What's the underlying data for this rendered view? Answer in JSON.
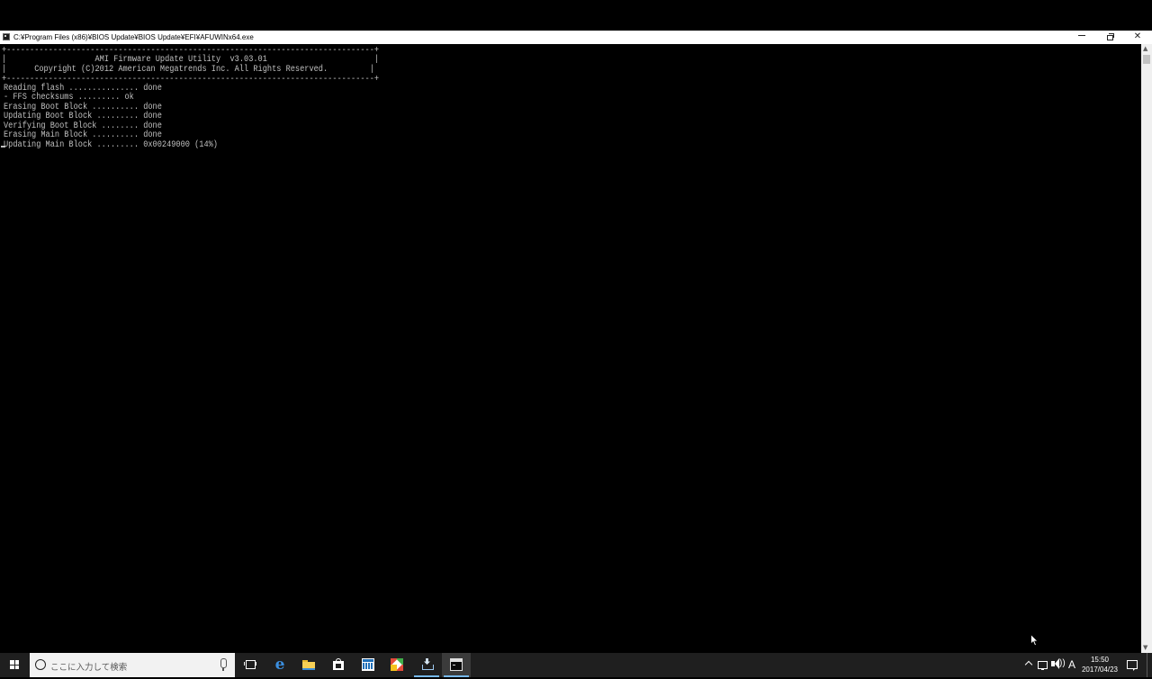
{
  "window": {
    "title": "C:¥Program Files (x86)¥BIOS Update¥BIOS Update¥EFI¥AFUWINx64.exe",
    "controls": {
      "minimize": "minimize",
      "maximize": "restore",
      "close": "✕"
    }
  },
  "console": {
    "lines": [
      "+-------------------------------------------------------------------------------+",
      "|                   AMI Firmware Update Utility  v3.03.01                       |",
      "|      Copyright (C)2012 American Megatrends Inc. All Rights Reserved.         |",
      "+-------------------------------------------------------------------------------+",
      "Reading flash ............... done",
      "- FFS checksums ......... ok",
      "Erasing Boot Block .......... done",
      "Updating Boot Block ......... done",
      "Verifying Boot Block ........ done",
      "Erasing Main Block .......... done",
      "Updating Main Block ......... 0x00249000 (14%)"
    ]
  },
  "taskbar": {
    "search_placeholder": "ここに入力して検索",
    "ime_indicator": "A",
    "clock": {
      "time": "15:50",
      "date": "2017/04/23"
    },
    "volume_waves": "))"
  },
  "colors": {
    "console_text": "#c0c0c0",
    "console_bg": "#000000",
    "taskbar_bg": "#1f1f1f",
    "active_indicator": "#76b9ed"
  }
}
